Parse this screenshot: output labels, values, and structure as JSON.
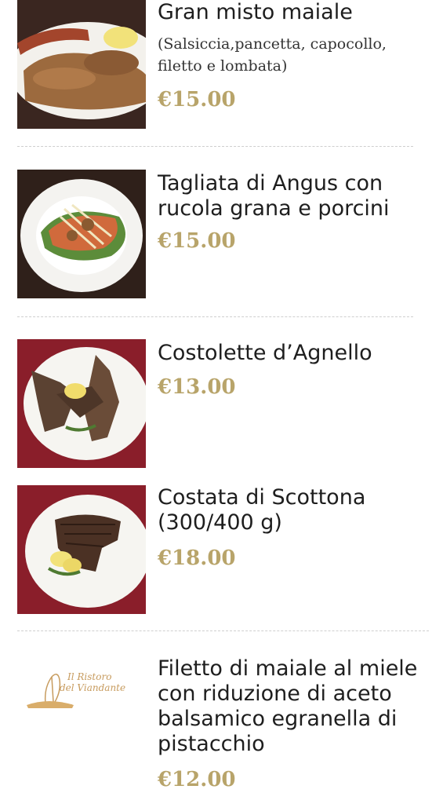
{
  "menu": {
    "items": [
      {
        "name": "Gran misto maiale",
        "description": "(Salsiccia,pancetta, capocollo, filetto e lombata)",
        "price": "€15.00",
        "image": "mixed-pork-grill-photo"
      },
      {
        "name": "Tagliata di Angus con rucola grana e porcini",
        "price": "€15.00",
        "image": "sliced-angus-beef-photo"
      },
      {
        "name": "Costolette d’Agnello",
        "price": "€13.00",
        "image": "lamb-chops-photo"
      },
      {
        "name": "Costata di Scottona (300/400 g)",
        "price": "€18.00",
        "image": "scottona-steak-photo"
      },
      {
        "name": "Filetto di maiale al miele con riduzione di aceto balsamico egranella di pistacchio",
        "price": "€12.00",
        "image": "restaurant-logo-placeholder",
        "logo_text": "Il Ristoro del Viandante"
      }
    ]
  },
  "colors": {
    "price": "#b8a46a",
    "divider": "#cfcfcf",
    "title": "#1e1e1e"
  }
}
